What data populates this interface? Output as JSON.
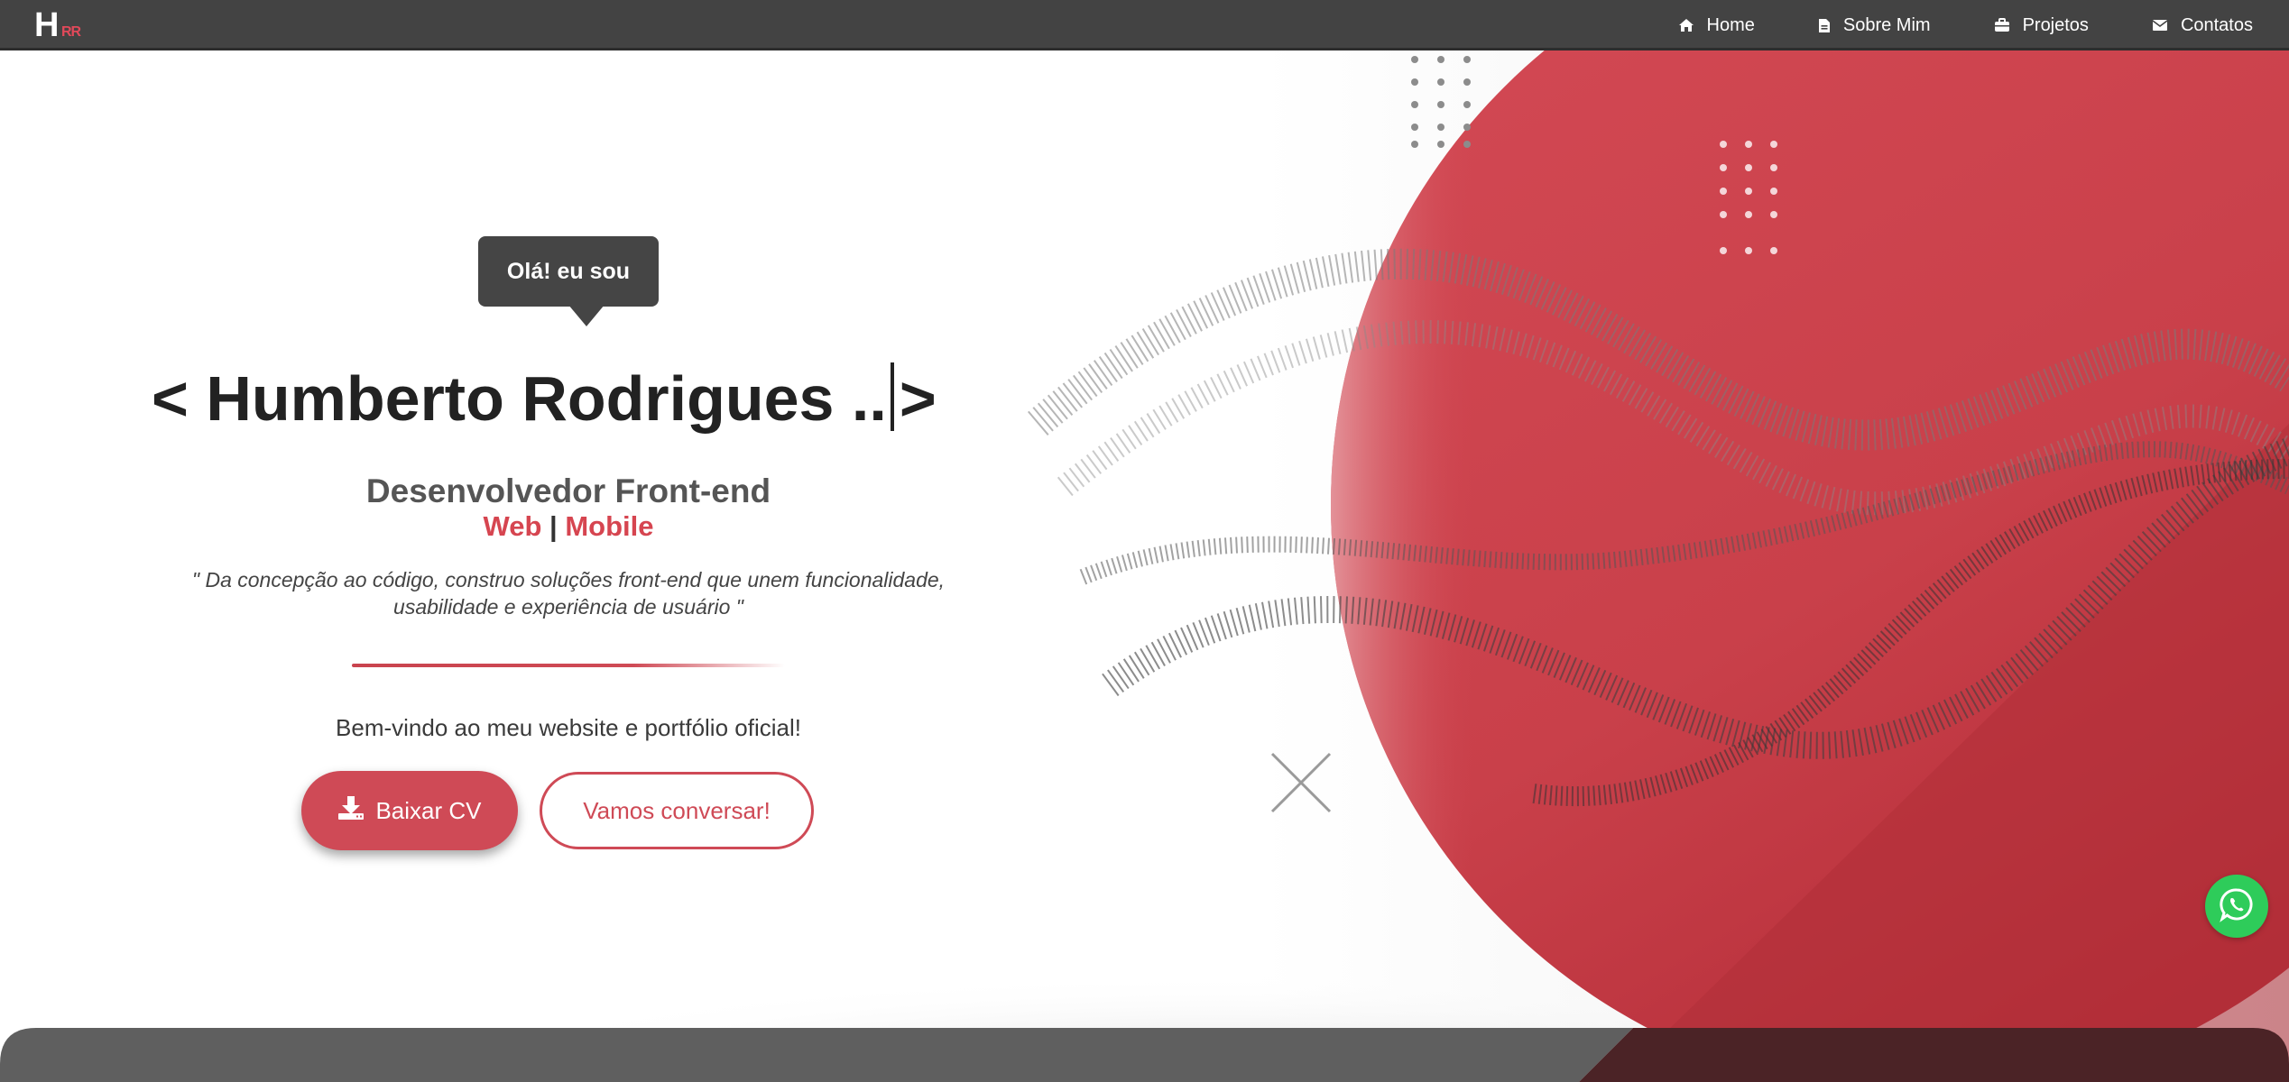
{
  "logo": {
    "letter": "H",
    "sub": "RR"
  },
  "nav": {
    "items": [
      {
        "label": "Home",
        "icon": "home-icon"
      },
      {
        "label": "Sobre Mim",
        "icon": "file-icon"
      },
      {
        "label": "Projetos",
        "icon": "briefcase-icon"
      },
      {
        "label": "Contatos",
        "icon": "envelope-icon"
      }
    ]
  },
  "hero": {
    "greeting": "Olá! eu sou",
    "name": "< Humberto Rodrigues ..",
    "name_close": ">",
    "role": "Desenvolvedor Front-end",
    "platform_web": "Web",
    "platform_sep": "|",
    "platform_mobile": "Mobile",
    "quote_line1": "\" Da concepção ao código, construo soluções front-end que unem funcionalidade,",
    "quote_line2": "usabilidade e experiência de usuário \"",
    "welcome": "Bem-vindo ao meu website e portfólio oficial!",
    "btn_cv": "Baixar CV",
    "btn_chat": "Vamos conversar!"
  },
  "colors": {
    "accent": "#d64550",
    "navbar": "#434343",
    "whatsapp": "#2ecc5a"
  }
}
